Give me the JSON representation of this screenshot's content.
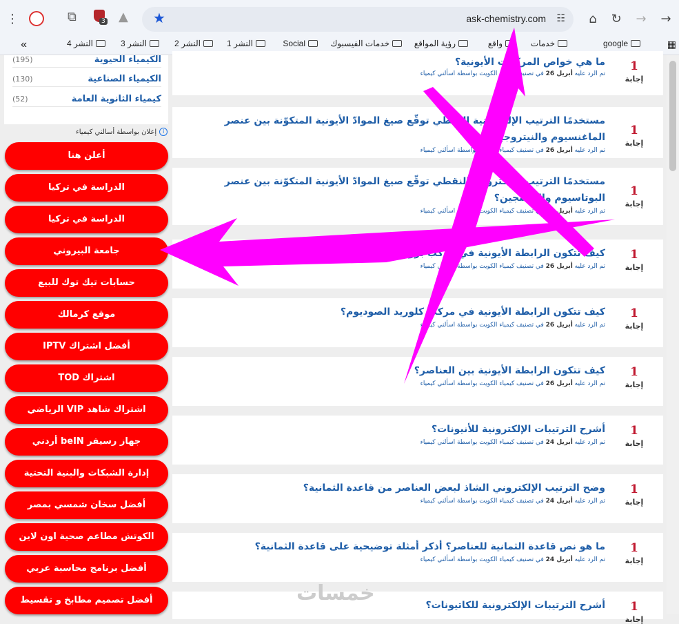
{
  "browser": {
    "url": "ask-chemistry.com",
    "extension_badge": "3",
    "bookmarks": [
      {
        "label": "google"
      },
      {
        "label": "خدمات"
      },
      {
        "label": "واقع"
      },
      {
        "label": "رؤية المواقع"
      },
      {
        "label": "خدمات الفيسبوك"
      },
      {
        "label": "Social"
      },
      {
        "label": "النشر 1"
      },
      {
        "label": "النشر 2"
      },
      {
        "label": "النشر 3"
      },
      {
        "label": "النشر 4"
      }
    ]
  },
  "sidebar": {
    "categories": [
      {
        "name": "الكيمياء الحيوية",
        "count": "(195)"
      },
      {
        "name": "الكيمياء الصناعية",
        "count": "(130)"
      },
      {
        "name": "كيمياء الثانوية العامة",
        "count": "(52)"
      }
    ],
    "ad_label": "إعلان بواسطة أسالني كيمياء",
    "ads": [
      "أعلن هنا",
      "الدراسة في تركيا",
      "الدراسة في تركيا",
      "جامعة البيروني",
      "حسابات تيك توك للبيع",
      "موقع كرمالك",
      "أفضل اشتراك IPTV",
      "اشتراك TOD",
      "اشتراك شاهد VIP الرياضي",
      "جهاز رسيفر beIN أردني",
      "إدارة الشبكات والبنية التحتية",
      "أفضل سخان شمسي بمصر",
      "الكوتش مطاعم صحية اون لاين",
      "أفضل برنامج محاسبة عربي",
      "أفضل تصميم مطابخ و تقسيط"
    ]
  },
  "questions": [
    {
      "answers": "1",
      "answers_label": "إجابة",
      "title": "ما هي خواص المركبات الأيونية؟",
      "meta_prefix": "تم الرد عليه",
      "date": "أبريل 26",
      "meta_suffix": "في تصنيف كيمياء الكويت بواسطة اسألني كيمياء"
    },
    {
      "answers": "1",
      "answers_label": "إجابة",
      "title": "مستخدمًا الترتيب الإلكترونية النقطي توقّع صيغ الموادّ الأيونية المتكوّنة بين عنصر الماغنسيوم والنيتروجين؟",
      "meta_prefix": "تم الرد عليه",
      "date": "أبريل 26",
      "meta_suffix": "في تصنيف كيمياء الكويت بواسطة اسألني كيمياء"
    },
    {
      "answers": "1",
      "answers_label": "إجابة",
      "title": "مستخدمًا الترتيب الإلكترونية النقطي توقّع صيغ الموادّ الأيونية المتكوّنة بين عنصر البوتاسيوم والأكسجين؟",
      "meta_prefix": "تم الرد عليه",
      "date": "أبريل 26",
      "meta_suffix": "في تصنيف كيمياء الكويت بواسطة اسألني كيمياء"
    },
    {
      "answers": "1",
      "answers_label": "إجابة",
      "title": "كيف تتكون الرابطة الأيونية في مركب بروميد الألومنيوم؟",
      "meta_prefix": "تم الرد عليه",
      "date": "أبريل 26",
      "meta_suffix": "في تصنيف كيمياء الكويت بواسطة اسألني كيمياء"
    },
    {
      "answers": "1",
      "answers_label": "إجابة",
      "title": "كيف تتكون الرابطة الأيونية في مركب كلوريد الصوديوم؟",
      "meta_prefix": "تم الرد عليه",
      "date": "أبريل 26",
      "meta_suffix": "في تصنيف كيمياء الكويت بواسطة اسألني كيمياء"
    },
    {
      "answers": "1",
      "answers_label": "إجابة",
      "title": "كيف تتكون الرابطة الأيونية بين العناصر؟",
      "meta_prefix": "تم الرد عليه",
      "date": "أبريل 26",
      "meta_suffix": "في تصنيف كيمياء الكويت بواسطة اسألني كيمياء"
    },
    {
      "answers": "1",
      "answers_label": "إجابة",
      "title": "أشرح الترتيبات الإلكترونية للأنيونات؟",
      "meta_prefix": "تم الرد عليه",
      "date": "أبريل 24",
      "meta_suffix": "في تصنيف كيمياء الكويت بواسطة اسألني كيمياء"
    },
    {
      "answers": "1",
      "answers_label": "إجابة",
      "title": "وضح الترتيب الإلكتروني الشاذ لبعض العناصر من قاعدة الثمانية؟",
      "meta_prefix": "تم الرد عليه",
      "date": "أبريل 24",
      "meta_suffix": "في تصنيف كيمياء الكويت بواسطة اسألني كيمياء"
    },
    {
      "answers": "1",
      "answers_label": "إجابة",
      "title": "ما هو نص قاعدة الثمانية للعناصر؟ أذكر أمثلة توضيحية على قاعدة الثمانية؟",
      "meta_prefix": "تم الرد عليه",
      "date": "أبريل 24",
      "meta_suffix": "في تصنيف كيمياء الكويت بواسطة اسألني كيمياء"
    },
    {
      "answers": "1",
      "answers_label": "إجابة",
      "title": "أشرح الترتيبات الإلكترونية للكاتيونات؟",
      "meta_prefix": "",
      "date": "",
      "meta_suffix": ""
    }
  ],
  "watermark": "خمسات",
  "colors": {
    "annotation": "#ff00ff",
    "ad_button": "#ff0000",
    "answer_count": "#c0182f",
    "link": "#1f5ea8"
  }
}
